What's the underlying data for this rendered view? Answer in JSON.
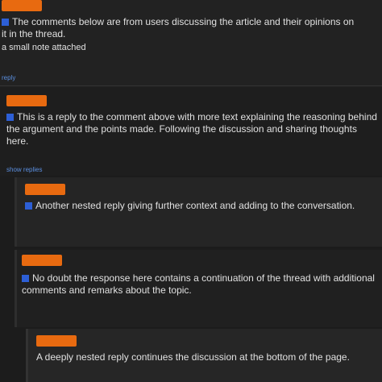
{
  "comments": [
    {
      "user": "",
      "meta": "",
      "body": "The comments below are from users discussing the article and their opinions on it in the thread.",
      "body_extra": "a small note attached",
      "link": "reply"
    },
    {
      "user": "",
      "meta": "",
      "body": "This is a reply to the comment above with more text explaining the reasoning behind the argument and the points made. Following the discussion and sharing thoughts here.",
      "link": "show replies"
    },
    {
      "user": "",
      "meta": "",
      "body": "Another nested reply giving further context and adding to the conversation."
    },
    {
      "user": "",
      "meta": "",
      "body": "No doubt the response here contains a continuation of the thread with additional comments and remarks about the topic."
    },
    {
      "user": "",
      "meta": "",
      "body": "A deeply nested reply continues the discussion at the bottom of the page."
    }
  ],
  "colors": {
    "badge": "#e86a10",
    "link": "#5b8fe0",
    "quote": "#2d5fd6"
  }
}
